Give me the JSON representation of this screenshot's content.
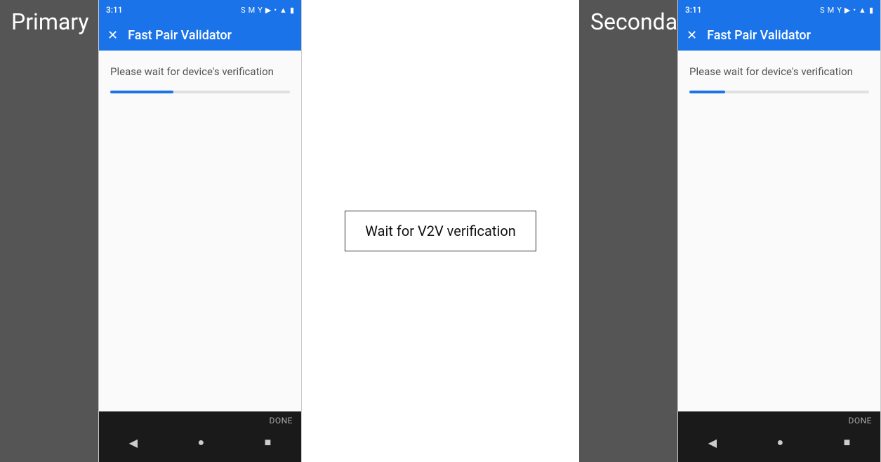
{
  "primary": {
    "label": "Primary",
    "labelBg": "#555555",
    "phone": {
      "statusBar": {
        "time": "3:11",
        "icons": [
          "S",
          "M",
          "Y",
          "▶",
          "•"
        ]
      },
      "appBar": {
        "closeIcon": "✕",
        "title": "Fast Pair Validator"
      },
      "content": {
        "verificationText": "Please wait for device's verification",
        "progressPercent": 35
      },
      "navBar": {
        "doneLabel": "DONE",
        "backIcon": "◀",
        "homeIcon": "●",
        "recentsIcon": "■"
      }
    }
  },
  "secondary": {
    "label": "Secondary",
    "labelBg": "#555555",
    "phone": {
      "statusBar": {
        "time": "3:11",
        "icons": [
          "S",
          "M",
          "Y",
          "▶",
          "•"
        ]
      },
      "appBar": {
        "closeIcon": "✕",
        "title": "Fast Pair Validator"
      },
      "content": {
        "verificationText": "Please wait for device's verification",
        "progressPercent": 20
      },
      "navBar": {
        "doneLabel": "DONE",
        "backIcon": "◀",
        "homeIcon": "●",
        "recentsIcon": "■"
      }
    }
  },
  "centerOverlay": {
    "text": "Wait for V2V verification"
  },
  "colors": {
    "accentBlue": "#1a73e8",
    "labelBg": "#555555",
    "navBg": "#1a1a1a",
    "progressBg": "#e0e0e0"
  }
}
